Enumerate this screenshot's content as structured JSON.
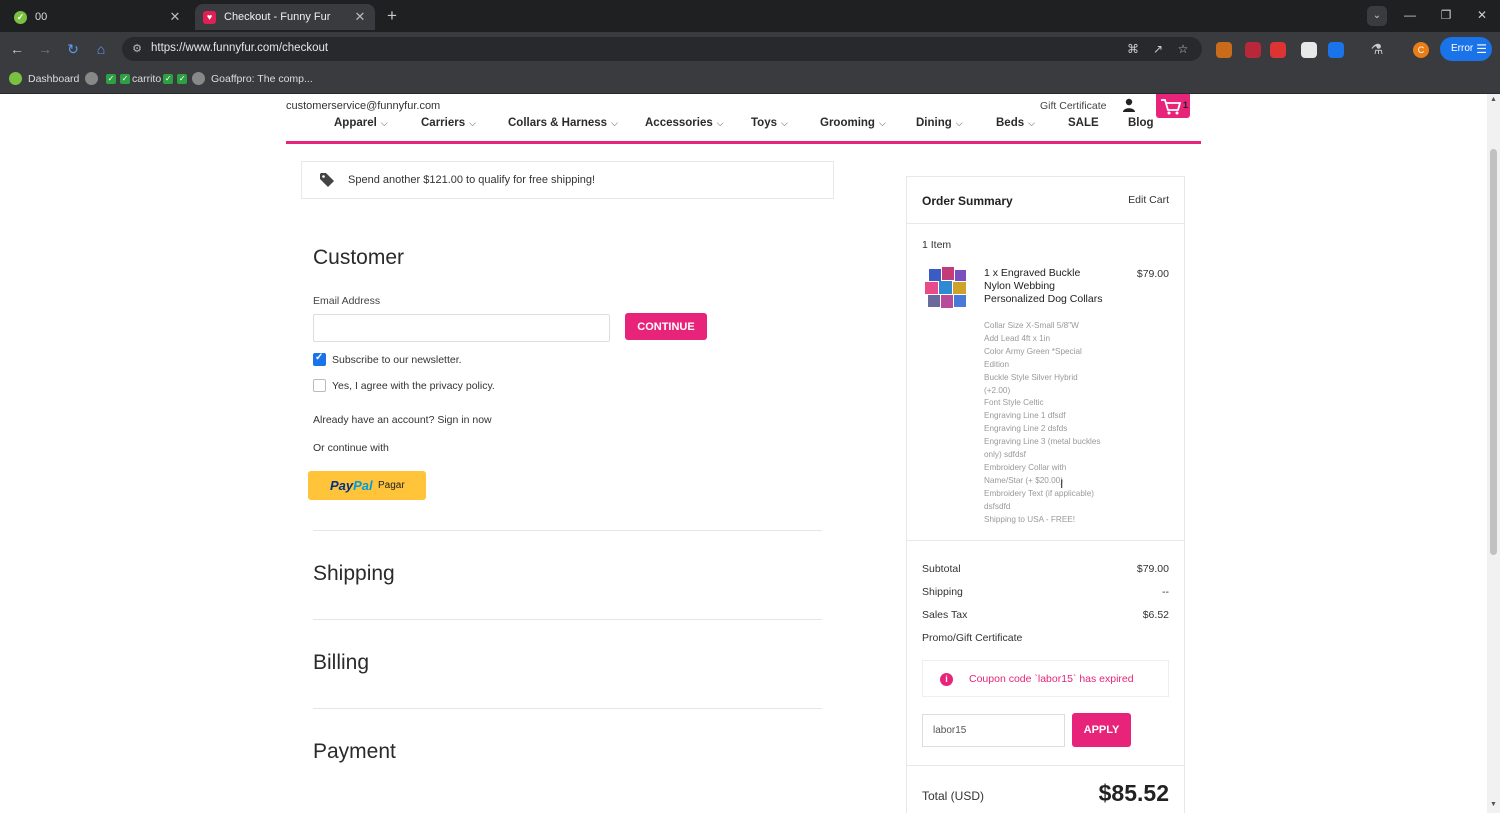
{
  "browser": {
    "tabs": [
      {
        "title": "00"
      },
      {
        "title": "Checkout - Funny Fur"
      }
    ],
    "url": "https://www.funnyfur.com/checkout",
    "bookmarks": {
      "dashboard": "Dashboard",
      "carrito": "carrito",
      "goaffpro": "Goaffpro: The comp..."
    },
    "error_label": "Error",
    "profile_initial": "C"
  },
  "site": {
    "email": "customerservice@funnyfur.com",
    "gift_certificate": "Gift Certificate",
    "cart_count": "1",
    "nav": [
      "Apparel",
      "Carriers",
      "Collars & Harness",
      "Accessories",
      "Toys",
      "Grooming",
      "Dining",
      "Beds",
      "SALE",
      "Blog"
    ],
    "brand_color": "#e8247a"
  },
  "checkout": {
    "free_shipping_msg": "Spend another $121.00 to qualify for free shipping!",
    "customer_heading": "Customer",
    "email_label": "Email Address",
    "email_value": "",
    "continue_label": "CONTINUE",
    "newsletter_label": "Subscribe to our newsletter.",
    "privacy_label": "Yes, I agree with the privacy policy.",
    "account_prompt": "Already have an account? Sign in now",
    "or_continue": "Or continue with",
    "paypal_pay": "Pay",
    "paypal_pal": "Pal",
    "paypal_pagar": "Pagar",
    "shipping_heading": "Shipping",
    "billing_heading": "Billing",
    "payment_heading": "Payment"
  },
  "summary": {
    "title": "Order Summary",
    "edit_cart": "Edit Cart",
    "item_count": "1 Item",
    "product_name": "1 x Engraved Buckle Nylon Webbing Personalized Dog Collars",
    "product_price": "$79.00",
    "options": [
      "Collar Size X-Small 5/8\"W",
      "Add Lead 4ft x 1in",
      "Color Army Green *Special Edition",
      "Buckle Style Silver Hybrid (+2.00)",
      "Font Style Celtic",
      "Engraving Line 1 dfsdf",
      "Engraving Line 2 dsfds",
      "Engraving Line 3 (metal buckles only) sdfdsf",
      "Embroidery Collar with Name/Star (+ $20.00)",
      "Embroidery Text (if applicable) dsfsdfd",
      "Shipping to USA - FREE!"
    ],
    "subtotal_label": "Subtotal",
    "subtotal": "$79.00",
    "shipping_label": "Shipping",
    "shipping": "--",
    "tax_label": "Sales Tax",
    "tax": "$6.52",
    "promo_label": "Promo/Gift Certificate",
    "coupon_error": "Coupon code `labor15` has expired",
    "coupon_value": "labor15",
    "apply_label": "APPLY",
    "total_label": "Total (USD)",
    "total": "$85.52"
  }
}
